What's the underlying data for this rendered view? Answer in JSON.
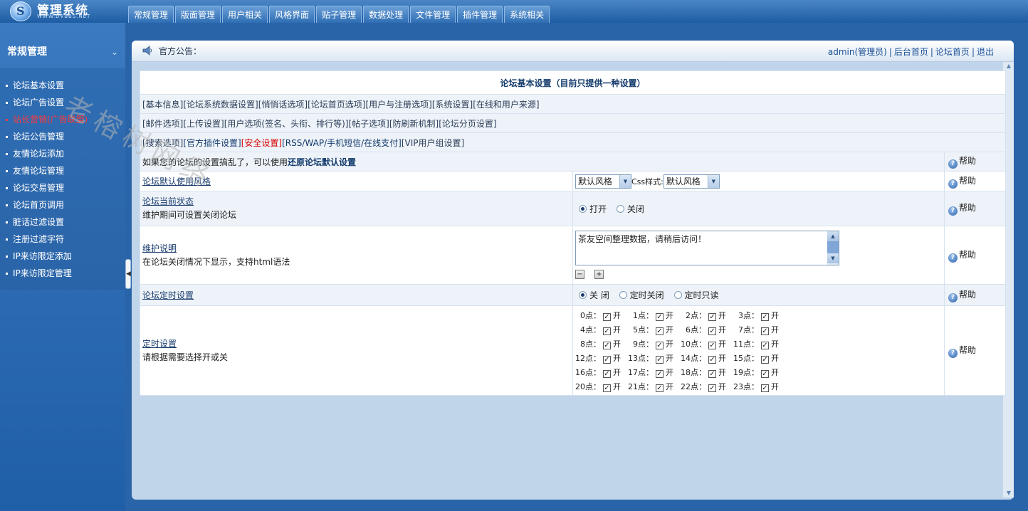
{
  "app": {
    "title": "管理系统",
    "subtitle": "WWW.DVBBS.NET"
  },
  "topnav": [
    "常规管理",
    "版面管理",
    "用户相关",
    "风格界面",
    "贴子管理",
    "数据处理",
    "文件管理",
    "插件管理",
    "系统相关"
  ],
  "sidebar": {
    "heading": "常规管理",
    "items": [
      {
        "label": "论坛基本设置",
        "active": false
      },
      {
        "label": "论坛广告设置",
        "active": false
      },
      {
        "label": "站长营销(广告联盟)",
        "active": true
      },
      {
        "label": "论坛公告管理",
        "active": false
      },
      {
        "label": "友情论坛添加",
        "active": false
      },
      {
        "label": "友情论坛管理",
        "active": false
      },
      {
        "label": "论坛交易管理",
        "active": false
      },
      {
        "label": "论坛首页调用",
        "active": false
      },
      {
        "label": "脏话过滤设置",
        "active": false
      },
      {
        "label": "注册过滤字符",
        "active": false
      },
      {
        "label": "IP来访限定添加",
        "active": false
      },
      {
        "label": "IP来访限定管理",
        "active": false
      }
    ]
  },
  "watermark": "老榕树网络",
  "header": {
    "notice_label": "官方公告：",
    "links": [
      "admin(管理员)",
      "后台首页",
      "论坛首页",
      "退出"
    ]
  },
  "content": {
    "title": "论坛基本设置（目前只提供一种设置）",
    "link_rows": [
      [
        "[基本信息]",
        "[论坛系统数据设置]",
        "[悄悄话选项]",
        "[论坛首页选项]",
        "[用户与注册选项]",
        "[系统设置]",
        "[在线和用户来源]"
      ],
      [
        "[邮件选项]",
        "[上传设置]",
        "[用户选项(签名、头衔、排行等)]",
        "[帖子选项]",
        "[防刷新机制]",
        "[论坛分页设置]"
      ],
      [
        "[搜索选项]",
        "[官方插件设置]",
        "[安全设置]",
        "[RSS/WAP/手机短信/在线支付]",
        "[VIP用户组设置]"
      ]
    ],
    "restore": {
      "prefix": "如果您的论坛的设置搞乱了，可以使用",
      "link": "还原论坛默认设置"
    },
    "help_label": "帮助",
    "style": {
      "label": "论坛默认使用风格",
      "value": "默认风格",
      "css_label": "Css样式:",
      "css_value": "默认风格"
    },
    "status": {
      "label": "论坛当前状态",
      "desc": "维护期间可设置关闭论坛",
      "options": [
        "打开",
        "关闭"
      ],
      "selected": "打开"
    },
    "maint": {
      "label": "维护说明",
      "desc": "在论坛关闭情况下显示，支持html语法",
      "value": "茶友空间整理数据，请稍后访问！"
    },
    "timer": {
      "label": "论坛定时设置",
      "options": [
        "关 闭",
        "定时关闭",
        "定时只读"
      ],
      "selected": "关 闭"
    },
    "schedule": {
      "label": "定时设置",
      "desc": "请根据需要选择开或关",
      "on_label": "开",
      "hours": [
        "0点：",
        "1点：",
        "2点：",
        "3点：",
        "4点：",
        "5点：",
        "6点：",
        "7点：",
        "8点：",
        "9点：",
        "10点：",
        "11点：",
        "12点：",
        "13点：",
        "14点：",
        "15点：",
        "16点：",
        "17点：",
        "18点：",
        "19点：",
        "20点：",
        "21点：",
        "22点：",
        "23点："
      ]
    }
  }
}
